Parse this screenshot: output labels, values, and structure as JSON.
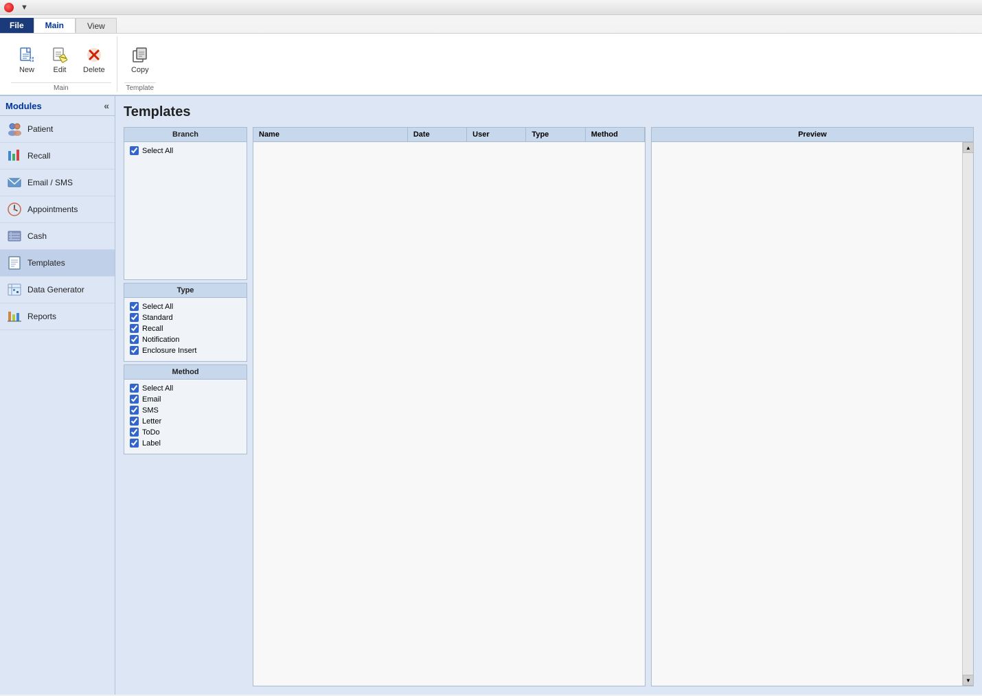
{
  "titlebar": {
    "quick_access": "▼"
  },
  "ribbon": {
    "tabs": [
      "File",
      "Main",
      "View"
    ],
    "active_tab": "Main",
    "groups": {
      "main": {
        "label": "Main",
        "buttons": [
          {
            "id": "new",
            "label": "New",
            "icon": "📄"
          },
          {
            "id": "edit",
            "label": "Edit",
            "icon": "✏️"
          },
          {
            "id": "delete",
            "label": "Delete",
            "icon": "✖"
          }
        ]
      },
      "template": {
        "label": "Template",
        "buttons": [
          {
            "id": "copy",
            "label": "Copy",
            "icon": "📋"
          }
        ]
      }
    }
  },
  "sidebar": {
    "title": "Modules",
    "collapse_icon": "«",
    "items": [
      {
        "id": "patient",
        "label": "Patient",
        "icon": "👥"
      },
      {
        "id": "recall",
        "label": "Recall",
        "icon": "📊"
      },
      {
        "id": "email-sms",
        "label": "Email / SMS",
        "icon": "📧"
      },
      {
        "id": "appointments",
        "label": "Appointments",
        "icon": "📅"
      },
      {
        "id": "cash",
        "label": "Cash",
        "icon": "🖩"
      },
      {
        "id": "templates",
        "label": "Templates",
        "icon": "📝"
      },
      {
        "id": "data-generator",
        "label": "Data Generator",
        "icon": "📋"
      },
      {
        "id": "reports",
        "label": "Reports",
        "icon": "📈"
      }
    ]
  },
  "page": {
    "title": "Templates"
  },
  "branch_section": {
    "header": "Branch",
    "select_all_label": "Select All",
    "select_all_checked": true,
    "items": []
  },
  "type_section": {
    "header": "Type",
    "checkboxes": [
      {
        "label": "Select All",
        "checked": true
      },
      {
        "label": "Standard",
        "checked": true
      },
      {
        "label": "Recall",
        "checked": true
      },
      {
        "label": "Notification",
        "checked": true
      },
      {
        "label": "Enclosure Insert",
        "checked": true
      }
    ]
  },
  "method_section": {
    "header": "Method",
    "checkboxes": [
      {
        "label": "Select All",
        "checked": true
      },
      {
        "label": "Email",
        "checked": true
      },
      {
        "label": "SMS",
        "checked": true
      },
      {
        "label": "Letter",
        "checked": true
      },
      {
        "label": "ToDo",
        "checked": true
      },
      {
        "label": "Label",
        "checked": true
      }
    ]
  },
  "table": {
    "columns": [
      "Name",
      "Date",
      "User",
      "Type",
      "Method"
    ]
  },
  "preview": {
    "header": "Preview"
  }
}
